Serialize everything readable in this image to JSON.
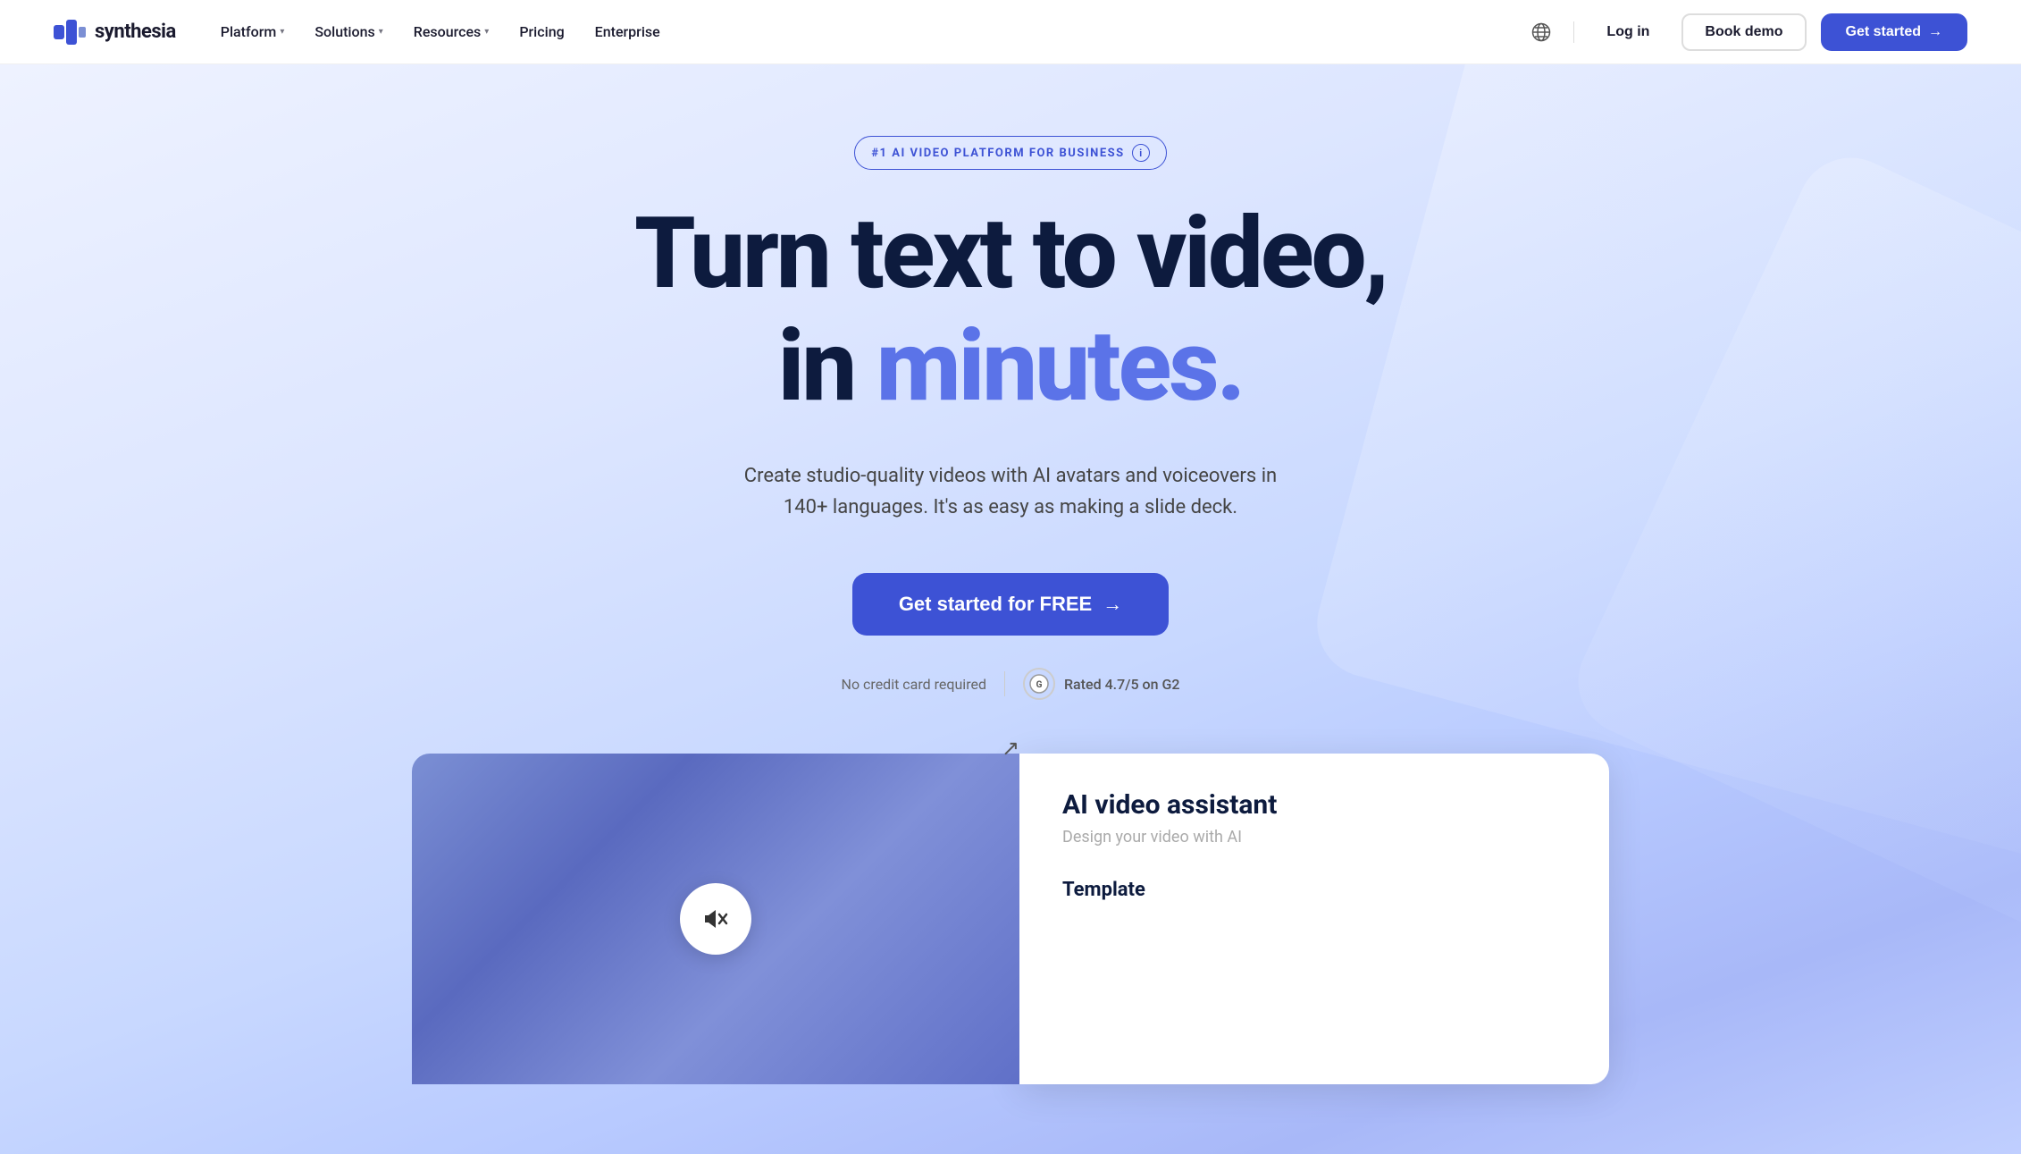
{
  "navbar": {
    "logo_text": "synthesia",
    "nav_items": [
      {
        "label": "Platform",
        "has_dropdown": true
      },
      {
        "label": "Solutions",
        "has_dropdown": true
      },
      {
        "label": "Resources",
        "has_dropdown": true
      },
      {
        "label": "Pricing",
        "has_dropdown": false
      },
      {
        "label": "Enterprise",
        "has_dropdown": false
      }
    ],
    "globe_icon": "🌐",
    "login_label": "Log in",
    "book_demo_label": "Book demo",
    "get_started_label": "Get started",
    "get_started_arrow": "→"
  },
  "hero": {
    "badge_text": "#1 AI VIDEO PLATFORM FOR BUSINESS",
    "badge_info": "i",
    "title_line1": "Turn text to video,",
    "title_line2_in": "in ",
    "title_line2_highlight": "minutes.",
    "subtitle_line1": "Create studio-quality videos with AI avatars and voiceovers in",
    "subtitle_line2": "140+ languages. It's as easy as making a slide deck.",
    "cta_label": "Get started for FREE",
    "cta_arrow": "→",
    "social_proof_text": "No credit card required",
    "g2_label": "Rated 4.7/5 on G2"
  },
  "preview": {
    "ai_panel_title": "AI video assistant",
    "ai_panel_subtitle": "Design your video with AI",
    "ai_panel_section": "Template",
    "mute_icon": "🔇"
  },
  "colors": {
    "brand_blue": "#3d52d5",
    "hero_bg_start": "#eef2ff",
    "hero_bg_end": "#a8b8f8",
    "title_dark": "#0d1b3e",
    "highlight_blue": "#5b73e8"
  }
}
